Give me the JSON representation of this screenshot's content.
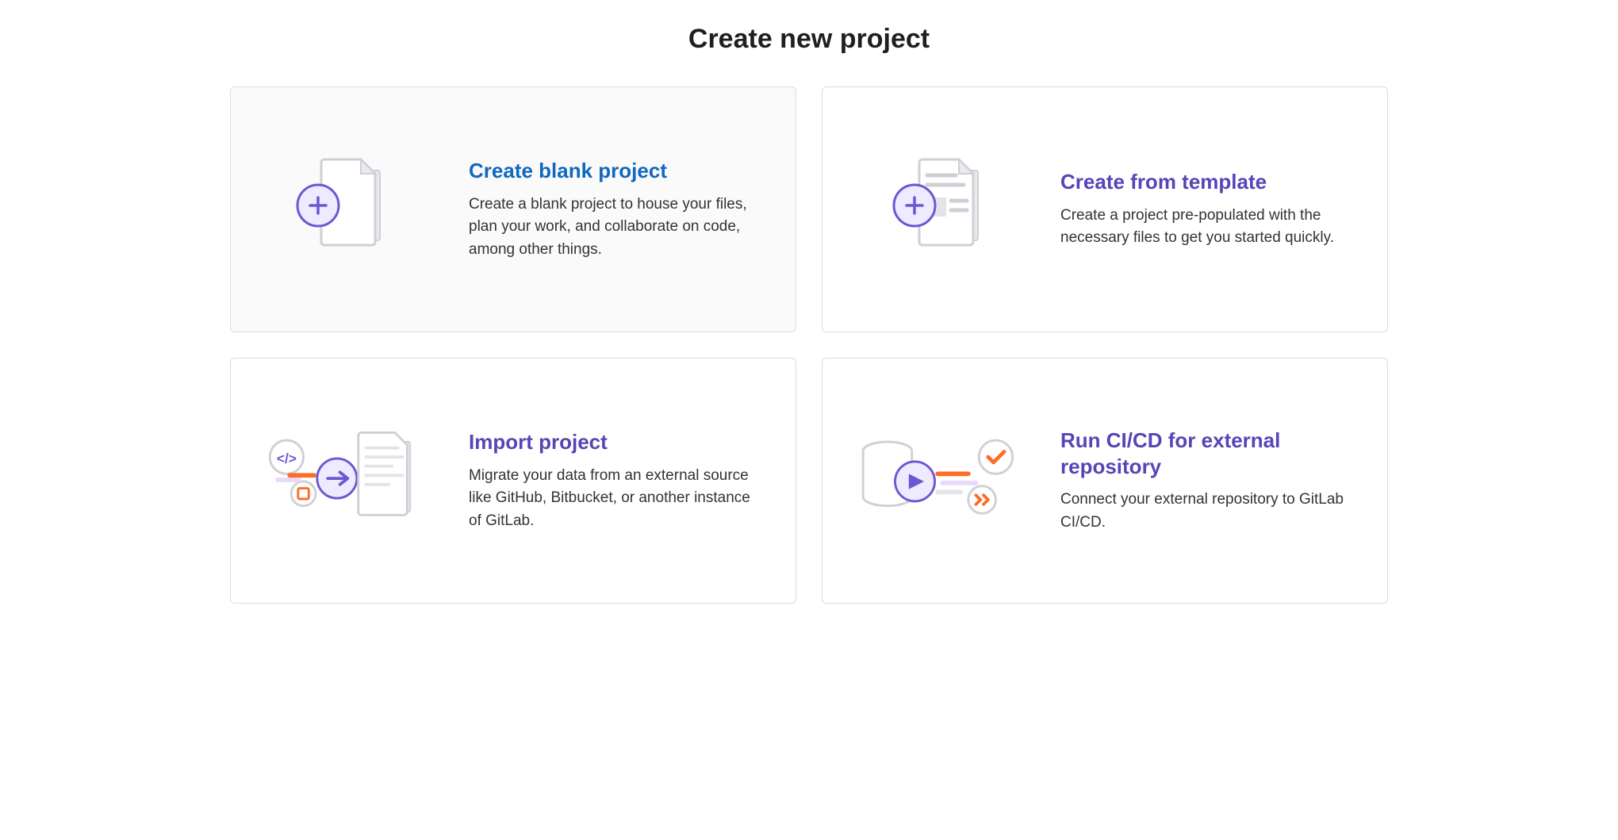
{
  "page": {
    "title": "Create new project"
  },
  "panels": [
    {
      "title": "Create blank project",
      "description": "Create a blank project to house your files, plan your work, and collaborate on code, among other things."
    },
    {
      "title": "Create from template",
      "description": "Create a project pre-populated with the necessary files to get you started quickly."
    },
    {
      "title": "Import project",
      "description": "Migrate your data from an external source like GitHub, Bitbucket, or another instance of GitLab."
    },
    {
      "title": "Run CI/CD for external repository",
      "description": "Connect your external repository to GitLab CI/CD."
    }
  ],
  "colors": {
    "heading_default": "#5943b6",
    "heading_active": "#1068bf",
    "purple": "#5943b6",
    "orange": "#fc6d26",
    "grey": "#d3d3d8"
  }
}
